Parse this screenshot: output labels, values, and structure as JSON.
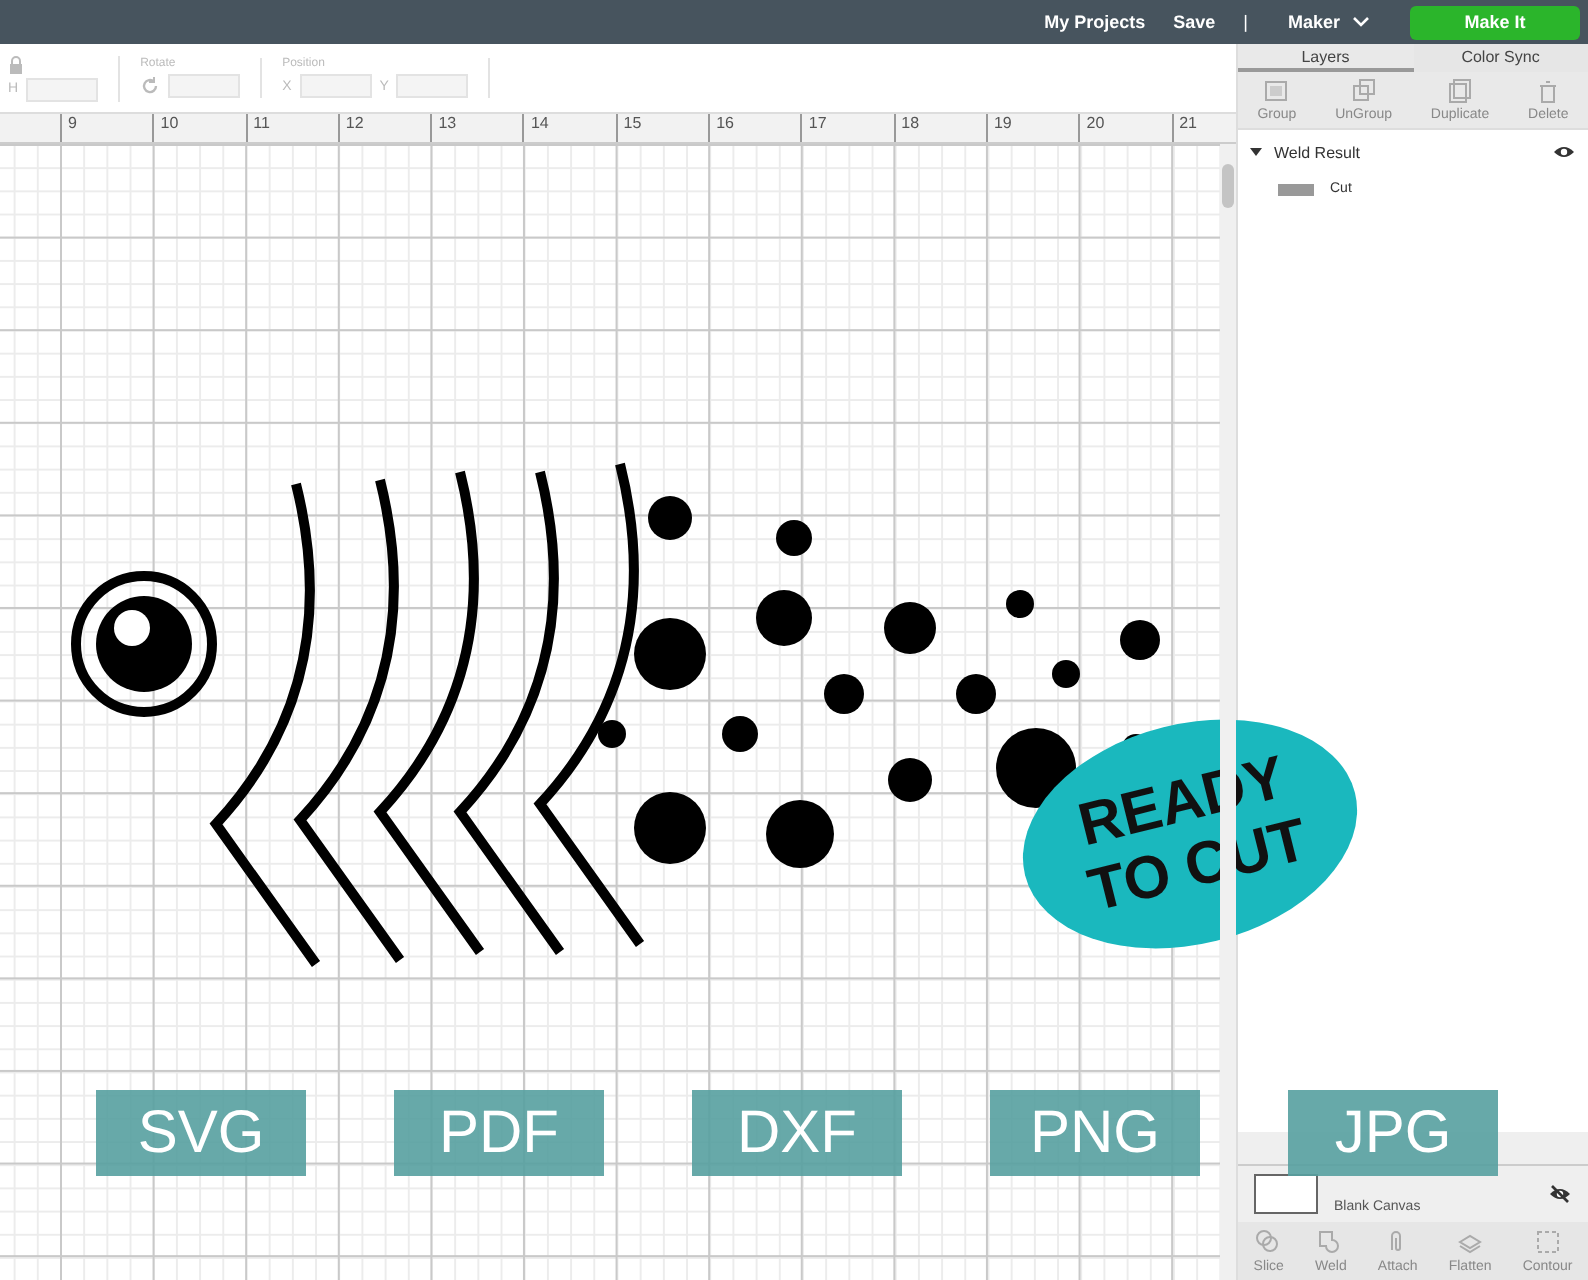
{
  "top_bar": {
    "links": [
      "My Projects",
      "Save"
    ],
    "separator": "|",
    "machine": "Maker",
    "make_it": "Make It"
  },
  "toolbar": {
    "size_label": "H",
    "rotate_label": "Rotate",
    "position_label": "Position",
    "x_label": "X",
    "y_label": "Y"
  },
  "ruler": [
    "9",
    "10",
    "11",
    "12",
    "13",
    "14",
    "15",
    "16",
    "17",
    "18",
    "19",
    "20",
    "21"
  ],
  "ready_badge": "READY TO CUT",
  "formats": [
    "SVG",
    "PDF",
    "DXF",
    "PNG",
    "JPG"
  ],
  "panel": {
    "tabs": [
      {
        "label": "Layers",
        "selected": true
      },
      {
        "label": "Color Sync",
        "selected": false
      }
    ],
    "actions": [
      {
        "label": "Group",
        "disabled": true
      },
      {
        "label": "UnGroup",
        "disabled": true
      },
      {
        "label": "Duplicate",
        "disabled": true
      },
      {
        "label": "Delete",
        "disabled": true
      }
    ],
    "layers": [
      {
        "name": "Weld Result",
        "expanded": true,
        "visible": true,
        "children": [
          {
            "name": "Cut"
          }
        ]
      }
    ],
    "blank_canvas": {
      "label": "Blank Canvas",
      "visible": false
    },
    "tools": [
      {
        "label": "Slice",
        "disabled": true
      },
      {
        "label": "Weld",
        "disabled": true
      },
      {
        "label": "Attach",
        "disabled": true
      },
      {
        "label": "Flatten",
        "disabled": true
      },
      {
        "label": "Contour",
        "disabled": true
      }
    ]
  }
}
